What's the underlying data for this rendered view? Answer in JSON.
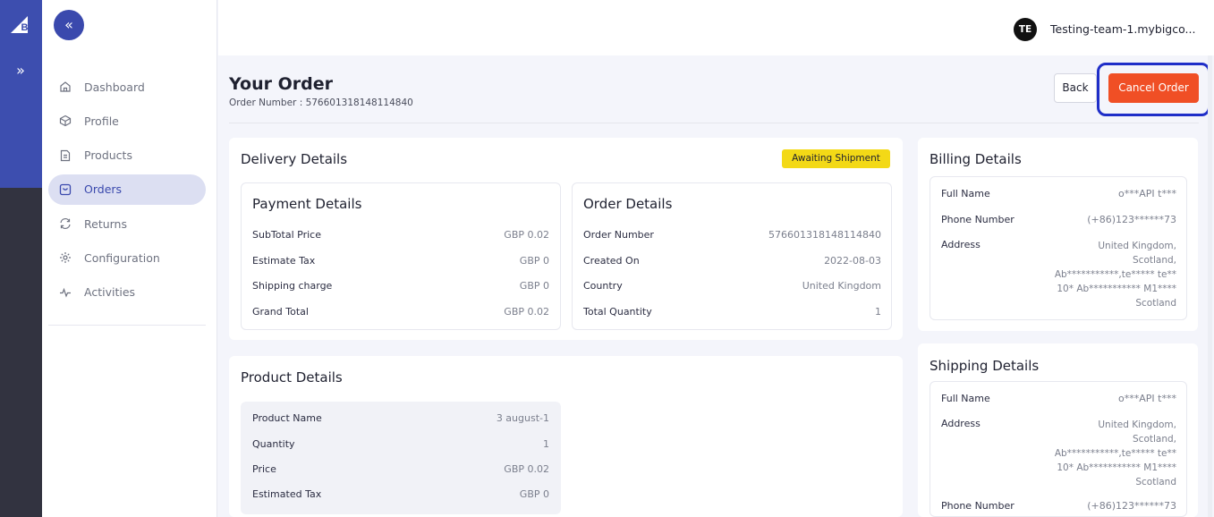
{
  "rail": {
    "logo_icon": "bigcommerce-logo-icon",
    "expand_icon": "double-chevron-right-icon",
    "expand_label": "»"
  },
  "nav": {
    "collapse_label": "«",
    "items": [
      {
        "label": "Dashboard",
        "icon": "home-icon",
        "active": false
      },
      {
        "label": "Profile",
        "icon": "cube-icon",
        "active": false
      },
      {
        "label": "Products",
        "icon": "document-icon",
        "active": false
      },
      {
        "label": "Orders",
        "icon": "cart-box-icon",
        "active": true
      },
      {
        "label": "Returns",
        "icon": "refresh-icon",
        "active": false
      },
      {
        "label": "Configuration",
        "icon": "gear-icon",
        "active": false
      },
      {
        "label": "Activities",
        "icon": "activity-icon",
        "active": false
      }
    ]
  },
  "topbar": {
    "avatar_initials": "TE",
    "store_name": "Testing-team-1.mybigco..."
  },
  "header": {
    "title": "Your Order",
    "order_number": "Order Number : 576601318148114840",
    "back_label": "Back",
    "cancel_label": "Cancel Order"
  },
  "delivery": {
    "title": "Delivery Details",
    "status": "Awaiting Shipment",
    "payment": {
      "title": "Payment Details",
      "rows": [
        {
          "k": "SubTotal Price",
          "v": "GBP 0.02"
        },
        {
          "k": "Estimate Tax",
          "v": "GBP 0"
        },
        {
          "k": "Shipping charge",
          "v": "GBP 0"
        },
        {
          "k": "Grand Total",
          "v": "GBP 0.02"
        }
      ]
    },
    "order": {
      "title": "Order Details",
      "rows": [
        {
          "k": "Order Number",
          "v": "576601318148114840"
        },
        {
          "k": "Created On",
          "v": "2022-08-03"
        },
        {
          "k": "Country",
          "v": "United Kingdom"
        },
        {
          "k": "Total Quantity",
          "v": "1"
        }
      ]
    }
  },
  "product": {
    "title": "Product Details",
    "rows": [
      {
        "k": "Product Name",
        "v": "3 august-1"
      },
      {
        "k": "Quantity",
        "v": "1"
      },
      {
        "k": "Price",
        "v": "GBP 0.02"
      },
      {
        "k": "Estimated Tax",
        "v": "GBP 0"
      }
    ]
  },
  "billing": {
    "title": "Billing Details",
    "full_name_label": "Full Name",
    "full_name": "o***API t***",
    "phone_label": "Phone Number",
    "phone": "(+86)123******73",
    "address_label": "Address",
    "address_lines": [
      "United Kingdom,",
      "Scotland,",
      "Ab***********,te***** te**",
      "10* Ab*********** M1****",
      "Scotland"
    ]
  },
  "shipping": {
    "title": "Shipping Details",
    "full_name_label": "Full Name",
    "full_name": "o***API t***",
    "address_label": "Address",
    "address_lines": [
      "United Kingdom,",
      "Scotland,",
      "Ab***********,te***** te**",
      "10* Ab*********** M1****",
      "Scotland"
    ],
    "phone_label": "Phone Number",
    "phone": "(+86)123******73"
  },
  "colors": {
    "accent": "#3a49ad",
    "cancel": "#f04f25",
    "badge": "#f3d916",
    "highlight": "#1f2ec8"
  }
}
